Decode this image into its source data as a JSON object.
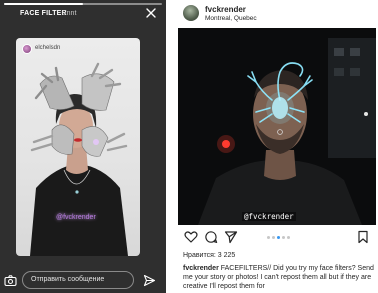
{
  "story": {
    "title": "FACE FILTER",
    "subtitle": "Ennt",
    "progress": 0.5,
    "card": {
      "username": "elchelsdn",
      "tag": "@fvckrender"
    },
    "message_placeholder": "Отправить сообщение",
    "icons": {
      "close": "close-icon",
      "camera": "camera-icon",
      "send": "send-icon"
    }
  },
  "post": {
    "username": "fvckrender",
    "location": "Montreal, Quebec",
    "media_tag": "@fvckrender",
    "likes": "Нравится: 3 225",
    "caption_user": "fvckrender",
    "caption_text": " FACEFILTERS// Did you try my face filters? Send me your story or photos! I can't repost them all but if they are creative I'll repost them for",
    "carousel": {
      "count": 5,
      "active": 2
    },
    "icons": {
      "like": "heart-icon",
      "comment": "comment-icon",
      "share": "share-icon",
      "save": "bookmark-icon"
    }
  }
}
